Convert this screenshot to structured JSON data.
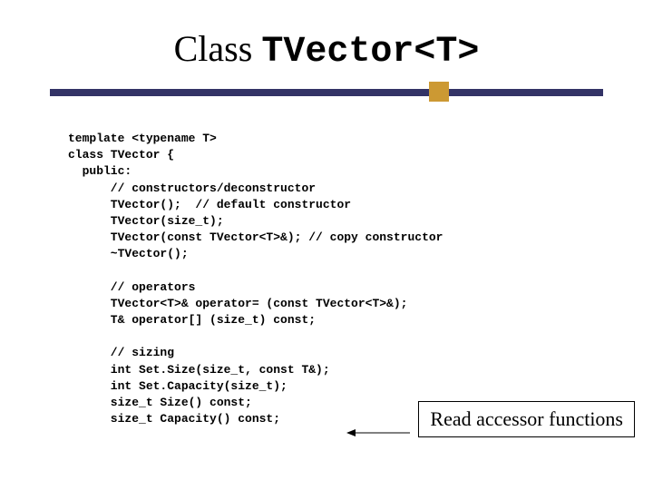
{
  "title": {
    "prefix": "Class ",
    "mono": "TVector<T>"
  },
  "code": {
    "lines": [
      "template <typename T>",
      "class TVector {",
      "  public:",
      "      // constructors/deconstructor",
      "      TVector();  // default constructor",
      "      TVector(size_t);",
      "      TVector(const TVector<T>&); // copy constructor",
      "      ~TVector();",
      "",
      "      // operators",
      "      TVector<T>& operator= (const TVector<T>&);",
      "      T& operator[] (size_t) const;",
      "",
      "      // sizing",
      "      int Set.Size(size_t, const T&);",
      "      int Set.Capacity(size_t);",
      "      size_t Size() const;",
      "      size_t Capacity() const;"
    ]
  },
  "callout": {
    "text": "Read accessor functions"
  }
}
